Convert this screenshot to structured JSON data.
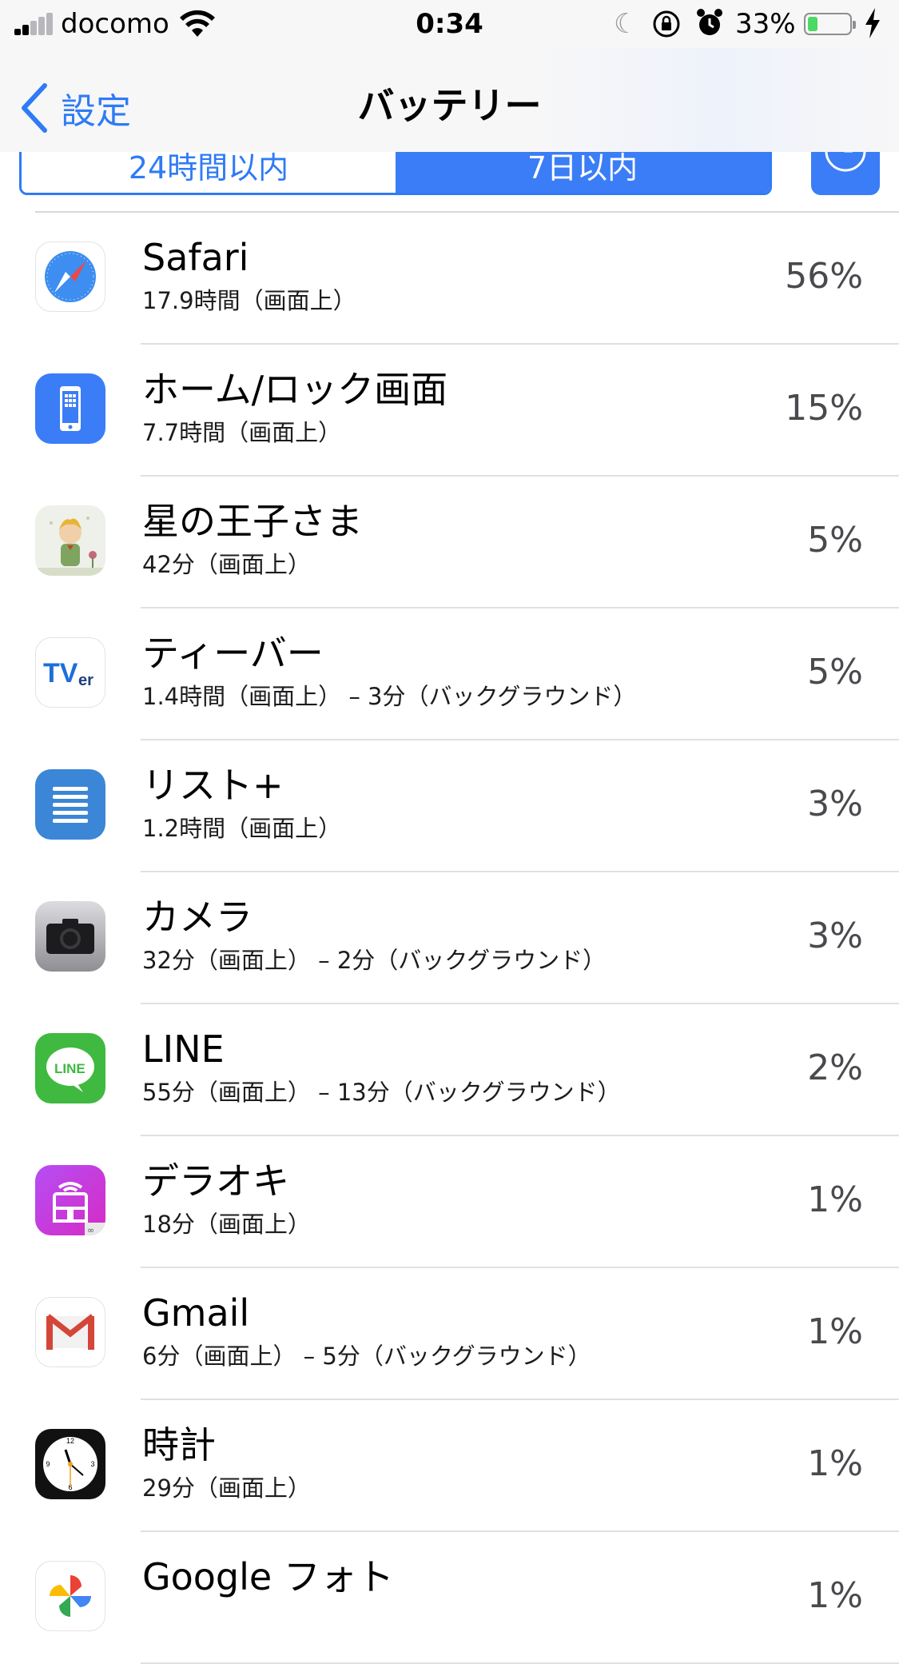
{
  "status_bar": {
    "carrier": "docomo",
    "time": "0:34",
    "battery_percent_label": "33%",
    "battery_level": 0.33
  },
  "nav": {
    "back_label": "設定",
    "title": "バッテリー"
  },
  "segment": {
    "options": [
      "24時間以内",
      "7日以内"
    ],
    "selected_index": 1
  },
  "colors": {
    "accent": "#2f7bf5",
    "battery_green": "#4cd964"
  },
  "apps": [
    {
      "icon": "safari-icon",
      "name": "Safari",
      "usage": "17.9時間（画面上）",
      "percent": "56%"
    },
    {
      "icon": "home-lock-screen-icon",
      "name": "ホーム/ロック画面",
      "usage": "7.7時間（画面上）",
      "percent": "15%"
    },
    {
      "icon": "little-prince-icon",
      "name": "星の王子さま",
      "usage": "42分（画面上）",
      "percent": "5%"
    },
    {
      "icon": "tver-icon",
      "name": "ティーバー",
      "usage": "1.4時間（画面上） – 3分（バックグラウンド）",
      "percent": "5%"
    },
    {
      "icon": "list-plus-icon",
      "name": "リスト+",
      "usage": "1.2時間（画面上）",
      "percent": "3%"
    },
    {
      "icon": "camera-icon",
      "name": "カメラ",
      "usage": "32分（画面上） – 2分（バックグラウンド）",
      "percent": "3%"
    },
    {
      "icon": "line-icon",
      "name": "LINE",
      "usage": "55分（画面上） – 13分（バックグラウンド）",
      "percent": "2%"
    },
    {
      "icon": "deraoki-icon",
      "name": "デラオキ",
      "usage": "18分（画面上）",
      "percent": "1%"
    },
    {
      "icon": "gmail-icon",
      "name": "Gmail",
      "usage": "6分（画面上） – 5分（バックグラウンド）",
      "percent": "1%"
    },
    {
      "icon": "clock-app-icon",
      "name": "時計",
      "usage": "29分（画面上）",
      "percent": "1%"
    },
    {
      "icon": "google-photos-icon",
      "name": "Google フォト",
      "usage": "",
      "percent": "1%"
    }
  ]
}
